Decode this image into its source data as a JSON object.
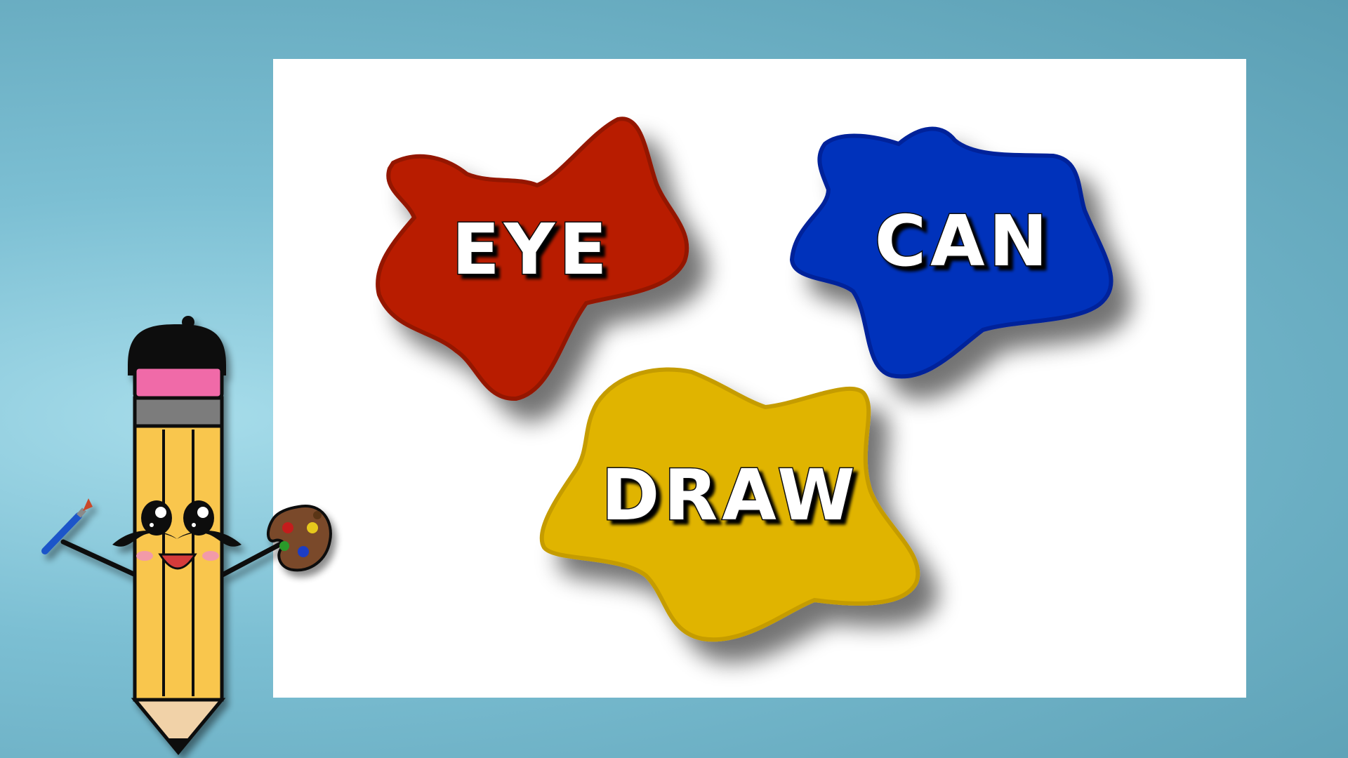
{
  "words": {
    "first": "EYE",
    "second": "CAN",
    "third": "DRAW"
  },
  "colors": {
    "background": "#6fb4c8",
    "canvas": "#ffffff",
    "red_blob": "#b81e00",
    "blue_blob": "#0033bb",
    "yellow_blob": "#e0b400",
    "pencil_body": "#f9c64e",
    "eraser": "#f06aa8"
  },
  "icons": {
    "mascot": "pencil-mascot",
    "brush": "paintbrush-icon",
    "palette": "paint-palette-icon"
  }
}
